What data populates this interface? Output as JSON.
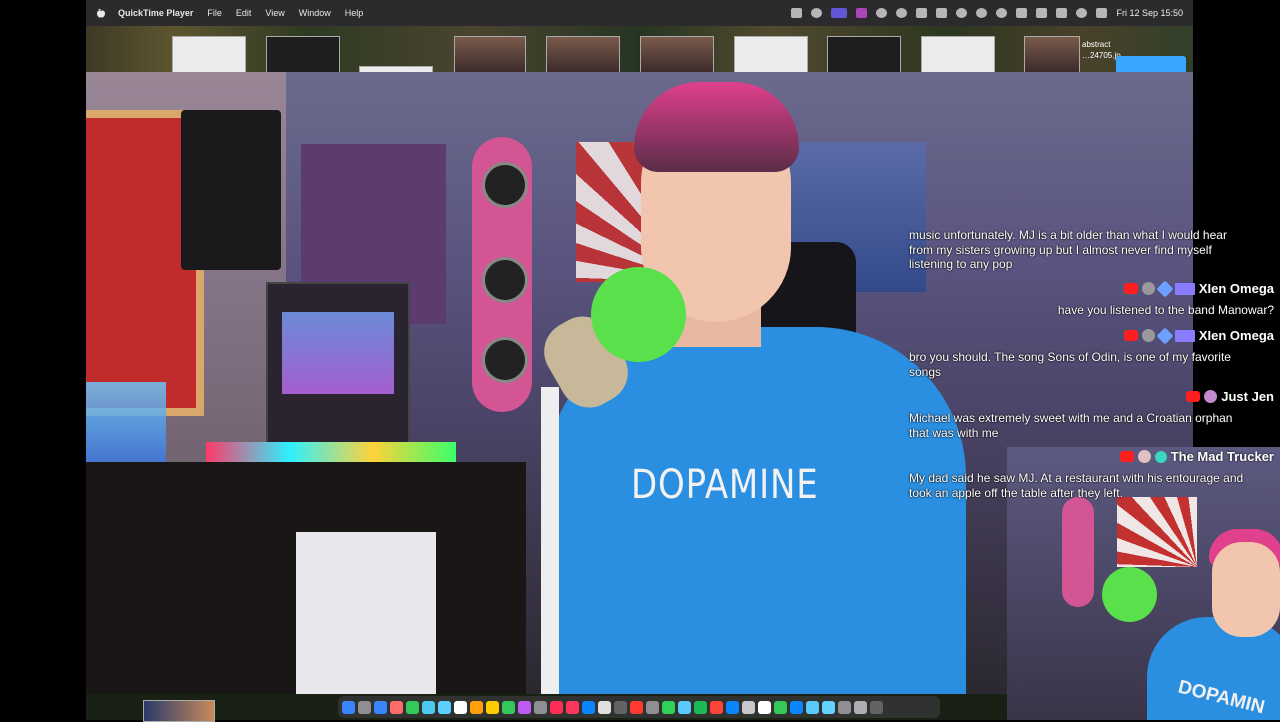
{
  "menubar": {
    "app_name": "QuickTime Player",
    "menus": [
      "File",
      "Edit",
      "View",
      "Window",
      "Help"
    ],
    "clock": "Fri 12 Sep  15:50"
  },
  "desktop": {
    "stage_caption_1": "abstract",
    "stage_caption_2": "…24705.jp"
  },
  "video": {
    "shirt_text": "DOPAMINE",
    "pip_shirt_text": "DOPAMIN"
  },
  "chat": {
    "messages": [
      {
        "text_lines": [
          "music unfortunately. MJ is a bit older than what I would hear",
          "from my sisters growing up but I almost never find myself",
          "listening to any pop"
        ]
      },
      {
        "user": "XIen Omega",
        "text_lines": [
          "have you listened to the band Manowar?"
        ]
      },
      {
        "user": "XIen Omega",
        "text_lines": [
          "bro you should. The song Sons of Odin, is one of my favorite",
          "songs"
        ]
      },
      {
        "user": "Just Jen",
        "text_lines": [
          "Michael was extremely sweet with me and a Croatian orphan",
          "that was with me"
        ]
      },
      {
        "user": "The Mad Trucker",
        "text_lines": [
          "My dad said he saw MJ. At a restaurant with his entourage and",
          "took an apple off the table after they left."
        ]
      }
    ]
  },
  "colors": {
    "menubar_bg": "#2c2a2c",
    "shirt_blue": "#2a8fe0",
    "hair_pink": "#e0408c",
    "mic_green": "#5ae04a",
    "youtube_red": "#ff1f1f"
  }
}
